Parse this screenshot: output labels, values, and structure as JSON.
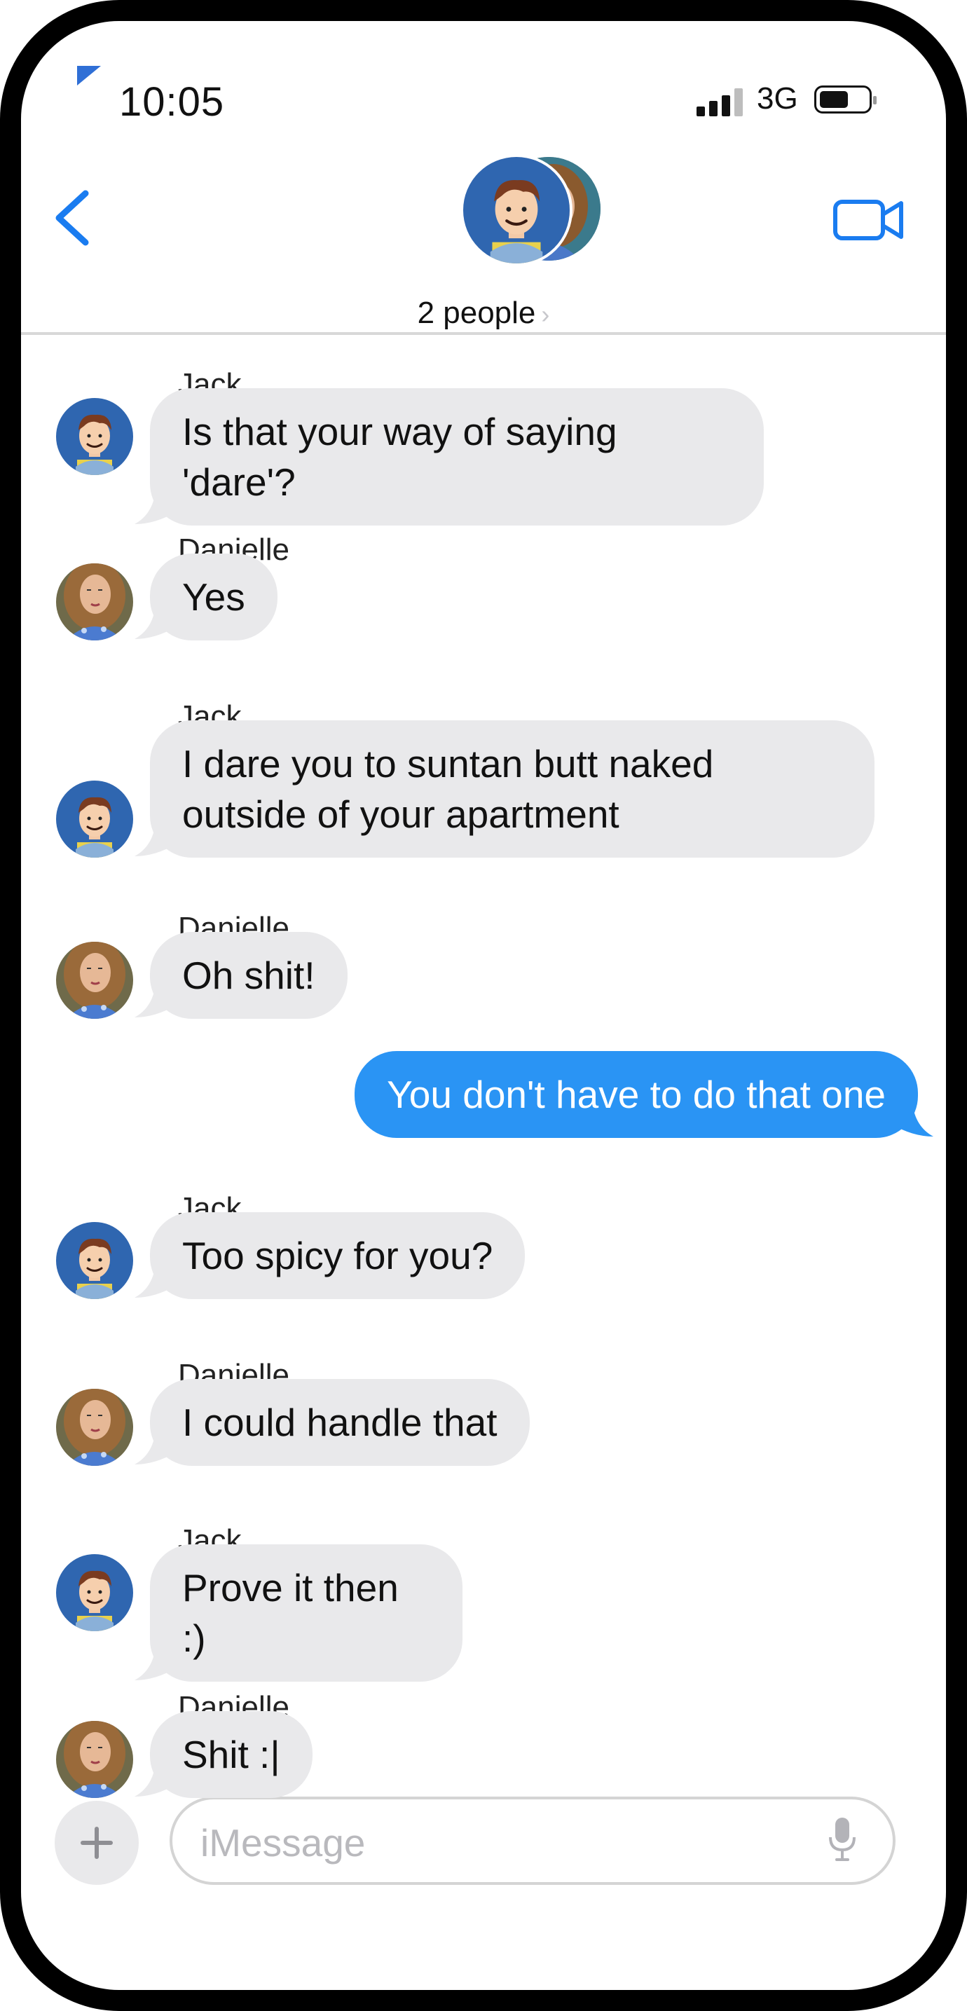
{
  "status_bar": {
    "time": "10:05",
    "network": "3G"
  },
  "header": {
    "title": "2 people",
    "chevron": "›"
  },
  "messages": [
    {
      "sender": "Jack",
      "text": "Is that your way of saying 'dare'?",
      "direction": "incoming"
    },
    {
      "sender": "Danielle",
      "text": "Yes",
      "direction": "incoming"
    },
    {
      "sender": "Jack",
      "text": "I dare you to suntan butt naked outside of your apartment",
      "direction": "incoming"
    },
    {
      "sender": "Danielle",
      "text": "Oh shit!",
      "direction": "incoming"
    },
    {
      "sender": "",
      "text": "You don't have to do that one",
      "direction": "outgoing"
    },
    {
      "sender": "Jack",
      "text": "Too spicy for you?",
      "direction": "incoming"
    },
    {
      "sender": "Danielle",
      "text": "I could handle that",
      "direction": "incoming"
    },
    {
      "sender": "Jack",
      "text": "Prove it then :)",
      "direction": "incoming"
    },
    {
      "sender": "Danielle",
      "text": "Shit :|",
      "direction": "incoming"
    }
  ],
  "input": {
    "placeholder": "iMessage"
  },
  "icons": {
    "back": "chevron-left-icon",
    "video": "video-camera-icon",
    "plus": "plus-icon",
    "mic": "microphone-icon",
    "signal": "signal-bars-icon",
    "battery": "battery-icon"
  },
  "colors": {
    "accent": "#1a7cf0",
    "outgoing_bubble": "#2a94f4",
    "incoming_bubble": "#e9e9eb"
  }
}
